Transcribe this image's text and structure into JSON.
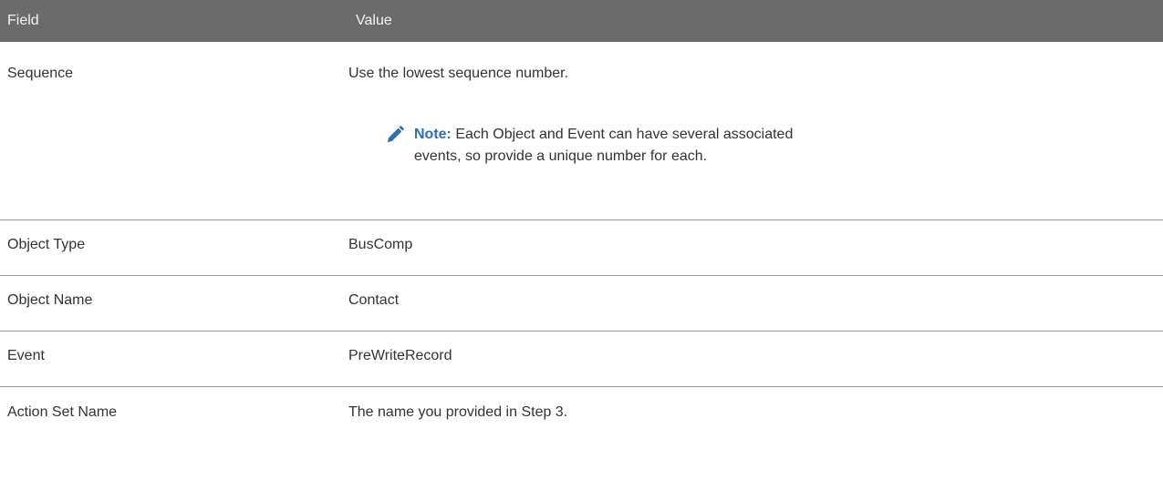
{
  "header": {
    "field_label": "Field",
    "value_label": "Value"
  },
  "rows": [
    {
      "field": "Sequence",
      "value": "Use the lowest sequence number.",
      "note": {
        "label": "Note:",
        "text": " Each Object and Event can have several associated events, so provide a unique number for each."
      }
    },
    {
      "field": "Object Type",
      "value": "BusComp"
    },
    {
      "field": "Object Name",
      "value": "Contact"
    },
    {
      "field": "Event",
      "value": "PreWriteRecord"
    },
    {
      "field": "Action Set Name",
      "value": "The name you provided in Step 3."
    }
  ],
  "colors": {
    "header_bg": "#6b6b6b",
    "note_accent": "#2c6fb4"
  },
  "icons": {
    "note": "pencil-icon"
  }
}
